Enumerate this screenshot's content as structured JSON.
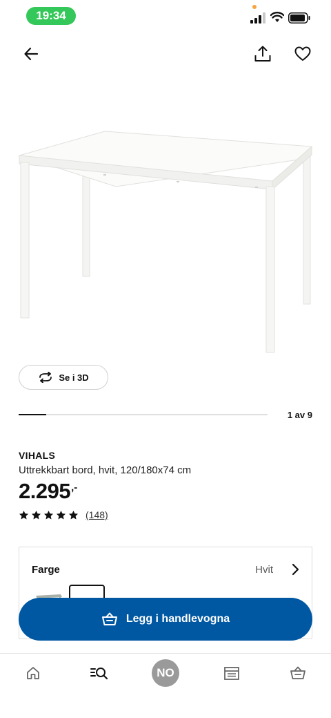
{
  "status_bar": {
    "time": "19:34"
  },
  "icons": {
    "back": "arrow-left-icon",
    "share": "share-icon",
    "favourite": "heart-icon",
    "view_3d": "rotate-3d-icon",
    "chevron": "chevron-right-icon",
    "cart": "shopping-basket-icon",
    "home": "home-icon",
    "search": "search-icon",
    "store": "store-icon"
  },
  "view_3d": {
    "label": "Se i 3D"
  },
  "carousel": {
    "counter": "1 av 9",
    "current": 1,
    "total": 9
  },
  "product": {
    "name": "VIHALS",
    "description": "Uttrekkbart bord, hvit, 120/180x74 cm",
    "price": "2.295",
    "price_suffix": ",-",
    "rating": 5,
    "review_count": "(148)"
  },
  "color": {
    "label": "Farge",
    "value": "Hvit"
  },
  "cart_button": {
    "label": "Legg i handlevogna"
  },
  "bottom_nav": {
    "profile_initials": "NO"
  },
  "colors": {
    "accent_blue": "#0058a3",
    "status_green": "#34c759",
    "profile_gray": "#9a9a9a"
  }
}
